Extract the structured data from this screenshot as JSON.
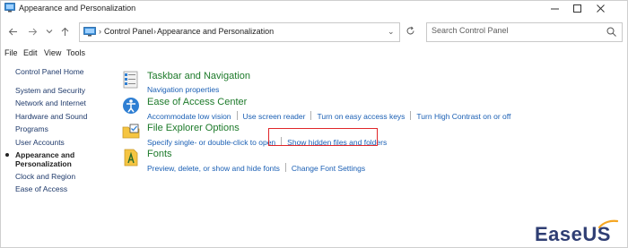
{
  "window": {
    "title": "Appearance and Personalization"
  },
  "navigation": {
    "back_icon": "back-arrow-icon",
    "forward_icon": "forward-arrow-icon",
    "recent_icon": "chevron-down-icon",
    "up_icon": "up-arrow-icon",
    "breadcrumb": [
      "Control Panel",
      "Appearance and Personalization"
    ],
    "search_placeholder": "Search Control Panel"
  },
  "menu": {
    "items": [
      "File",
      "Edit",
      "View",
      "Tools"
    ]
  },
  "sidebar": {
    "home": "Control Panel Home",
    "items": [
      "System and Security",
      "Network and Internet",
      "Hardware and Sound",
      "Programs",
      "User Accounts",
      "Appearance and",
      "Personalization",
      "Clock and Region",
      "Ease of Access"
    ]
  },
  "categories": [
    {
      "title": "Taskbar and Navigation",
      "icon": "taskbar-icon",
      "links": [
        "Navigation properties"
      ]
    },
    {
      "title": "Ease of Access Center",
      "icon": "ease-of-access-icon",
      "links": [
        "Accommodate low vision",
        "Use screen reader",
        "Turn on easy access keys",
        "Turn High Contrast on or off"
      ]
    },
    {
      "title": "File Explorer Options",
      "icon": "folder-options-icon",
      "links": [
        "Specify single- or double-click to open",
        "Show hidden files and folders"
      ]
    },
    {
      "title": "Fonts",
      "icon": "fonts-icon",
      "links": [
        "Preview, delete, or show and hide fonts",
        "Change Font Settings"
      ]
    }
  ],
  "highlight_color": "#e0262a",
  "watermark": {
    "text": "EaseUS",
    "color": "#2f3e73",
    "accent": "#f5a623"
  }
}
